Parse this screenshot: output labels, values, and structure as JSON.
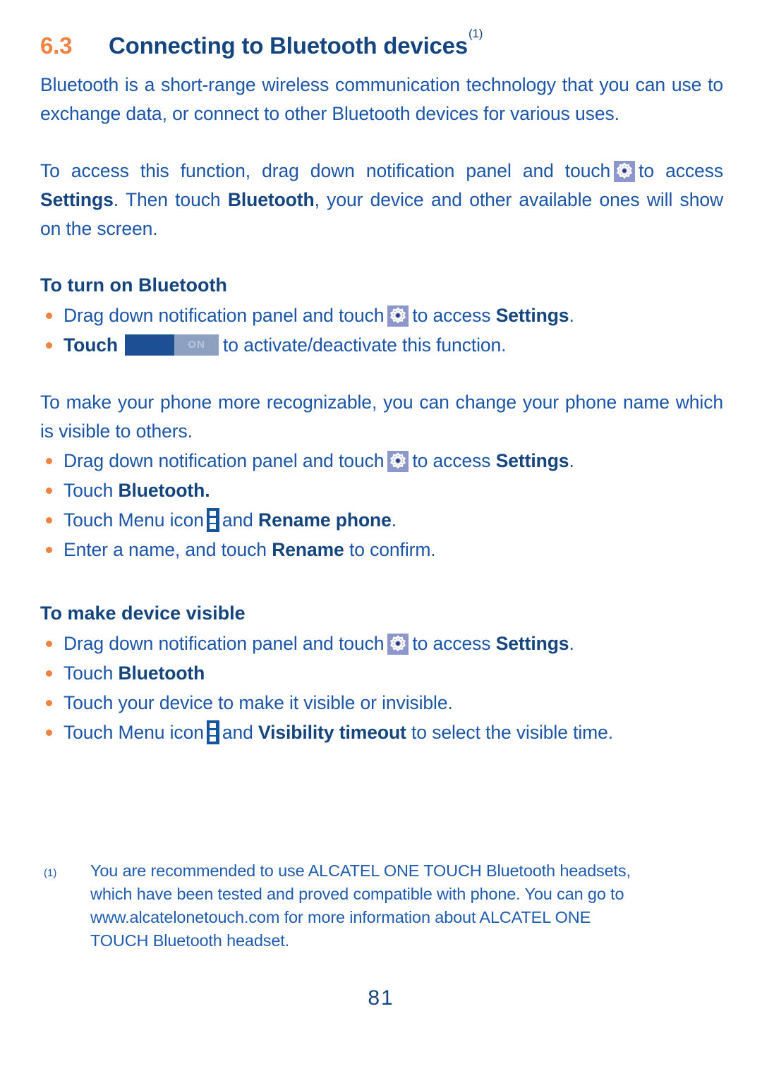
{
  "document": {
    "section_number": "6.3",
    "section_title": "Connecting to Bluetooth devices",
    "section_title_footnote_marker": "(1)",
    "page_number": "81"
  },
  "colors": {
    "accent_orange": "#F08340",
    "heading_blue": "#14457E",
    "body_blue": "#1B55A8",
    "footnote_blue": "#1F5BAE",
    "gear_icon_bg": "#8E97CB",
    "menu_icon_bg": "#14559E",
    "toggle_knob": "#1C4F93",
    "toggle_track": "#8EA0C0"
  },
  "intro": {
    "paragraph1": "Bluetooth is a short-range wireless communication technology that you can use to exchange data, or connect to other Bluetooth devices for various uses.",
    "paragraph2_part1": "To access this function, drag down notification panel and touch",
    "paragraph2_part2": "to access",
    "paragraph2_settings": "Settings",
    "paragraph2_part3": ". Then touch",
    "paragraph2_bluetooth": "Bluetooth",
    "paragraph2_part4": ", your device and other available ones will show on the screen."
  },
  "section_turn_on": {
    "heading": "To turn on Bluetooth",
    "bullet1_part1": "Drag down notification panel and touch",
    "bullet1_part2": "to access",
    "bullet1_settings": "Settings",
    "bullet1_part3": ".",
    "bullet2_touch": "Touch",
    "bullet2_toggle_label": "ON",
    "bullet2_part2": "to activate/deactivate this function."
  },
  "section_rename": {
    "paragraph": "To make your phone more recognizable, you can change your phone name which is visible to others.",
    "bullet1_part1": "Drag down notification panel and touch",
    "bullet1_part2": "to access",
    "bullet1_settings": "Settings",
    "bullet1_part3": ".",
    "bullet2_part1": "Touch",
    "bullet2_bold": "Bluetooth.",
    "bullet3_part1": "Touch Menu icon",
    "bullet3_bold": "Rename phone",
    "bullet3_and": "and",
    "bullet3_part3": ".",
    "bullet4_part1": "Enter a name, and touch",
    "bullet4_bold": "Rename",
    "bullet4_part2": "to confirm."
  },
  "section_visible": {
    "heading": "To make device visible",
    "bullet1_part1": "Drag down notification panel and touch",
    "bullet1_part2": "to access",
    "bullet1_settings": "Settings",
    "bullet1_part3": ".",
    "bullet2_part1": "Touch",
    "bullet2_bold": "Bluetooth",
    "bullet3": "Touch your device to make it visible or invisible.",
    "bullet4_part1": "Touch Menu icon",
    "bullet4_and": "and",
    "bullet4_bold": "Visibility timeout",
    "bullet4_part2": "to select the visible time."
  },
  "footnote": {
    "marker": "(1)",
    "line1": "You are recommended to use ALCATEL ONE TOUCH Bluetooth headsets,",
    "line2": "which have been tested and proved compatible with phone. You can go to",
    "line3": "www.alcatelonetouch.com for more information about ALCATEL ONE",
    "line4": "TOUCH Bluetooth headset."
  },
  "icons": {
    "settings_gear": "settings-gear-icon",
    "menu_overflow": "menu-overflow-icon",
    "toggle": "toggle-switch-on"
  }
}
